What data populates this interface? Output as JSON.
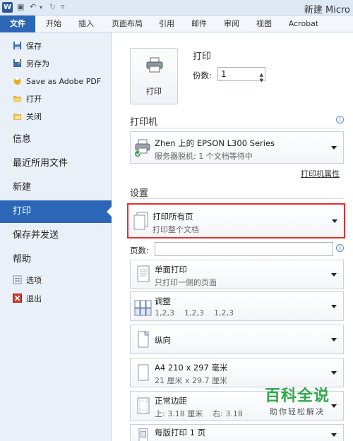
{
  "titlebar": {
    "logo": "W",
    "title": "新建 Micro"
  },
  "ribbon": {
    "tabs": [
      "文件",
      "开始",
      "插入",
      "页面布局",
      "引用",
      "邮件",
      "审阅",
      "视图",
      "Acrobat"
    ]
  },
  "nav": {
    "small_items": [
      "保存",
      "另存为",
      "Save as Adobe PDF",
      "打开",
      "关闭"
    ],
    "big_items": [
      "信息",
      "最近所用文件",
      "新建",
      "打印",
      "保存并发送",
      "帮助"
    ],
    "bottom_items": [
      "选项",
      "退出"
    ],
    "active": "打印"
  },
  "print": {
    "section_title": "打印",
    "button_label": "打印",
    "copies_label": "份数:",
    "copies_value": "1"
  },
  "printer": {
    "section_title": "打印机",
    "name": "Zhen 上的 EPSON L300 Series",
    "status": "服务器脱机: 1 个文档等待中",
    "properties_link": "打印机属性"
  },
  "settings": {
    "section_title": "设置",
    "pages_label": "页数:",
    "pages_value": "",
    "items": [
      {
        "main": "打印所有页",
        "sub": "打印整个文档"
      },
      {
        "main": "单面打印",
        "sub": "只打印一侧的页面"
      },
      {
        "main": "调整",
        "sub": "1,2,3    1,2,3    1,2,3"
      },
      {
        "main": "纵向",
        "sub": ""
      },
      {
        "main": "A4 210 x 297 毫米",
        "sub": "21 厘米 x 29.7 厘米"
      },
      {
        "main": "正常边距",
        "sub": "上: 3.18 厘米    右: 3.18"
      },
      {
        "main": "每版打印 1 页",
        "sub": ""
      }
    ]
  },
  "watermark": {
    "title": "百科全说",
    "subtitle": "助你轻松解决"
  },
  "colors": {
    "accent": "#2b67b6",
    "highlight": "#e03030",
    "watermark_green": "#2ea84a"
  }
}
